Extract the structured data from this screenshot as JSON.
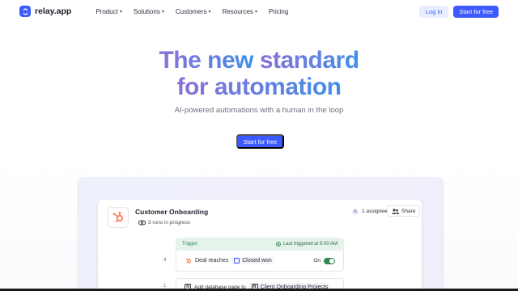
{
  "nav": {
    "logo_text": "relay.app",
    "menu": [
      {
        "label": "Product",
        "has_dropdown": true
      },
      {
        "label": "Solutions",
        "has_dropdown": true
      },
      {
        "label": "Customers",
        "has_dropdown": true
      },
      {
        "label": "Resources",
        "has_dropdown": true
      },
      {
        "label": "Pricing",
        "has_dropdown": false
      }
    ],
    "login_label": "Log in",
    "cta_label": "Start for free"
  },
  "hero": {
    "title_line1_word1": "The new",
    "title_line1_word2": "standard",
    "title_line2": "for automation",
    "subtitle": "AI-powered automations with a human in the loop",
    "cta_label": "Start for free"
  },
  "demo": {
    "workflow_title": "Customer Onboarding",
    "runs_status": "3 runs in progress",
    "assignee_initial": "A",
    "assignee_label": "1 assignee",
    "share_label": "Share",
    "trigger": {
      "header_label": "Trigger",
      "last_triggered": "Last triggered at 9:00 AM",
      "step_number": "4",
      "text_prefix": "Deal reaches",
      "stage_pill": "Closed won",
      "toggle_label": "On",
      "toggle_on": true
    },
    "action": {
      "step_number": "1",
      "text_prefix": "Add database page to",
      "target_pill": "Client Onboarding Projects"
    }
  },
  "colors": {
    "brand": "#3d5afe",
    "trigger_green": "#2f8a4f",
    "hubspot_orange": "#ff7a59"
  }
}
